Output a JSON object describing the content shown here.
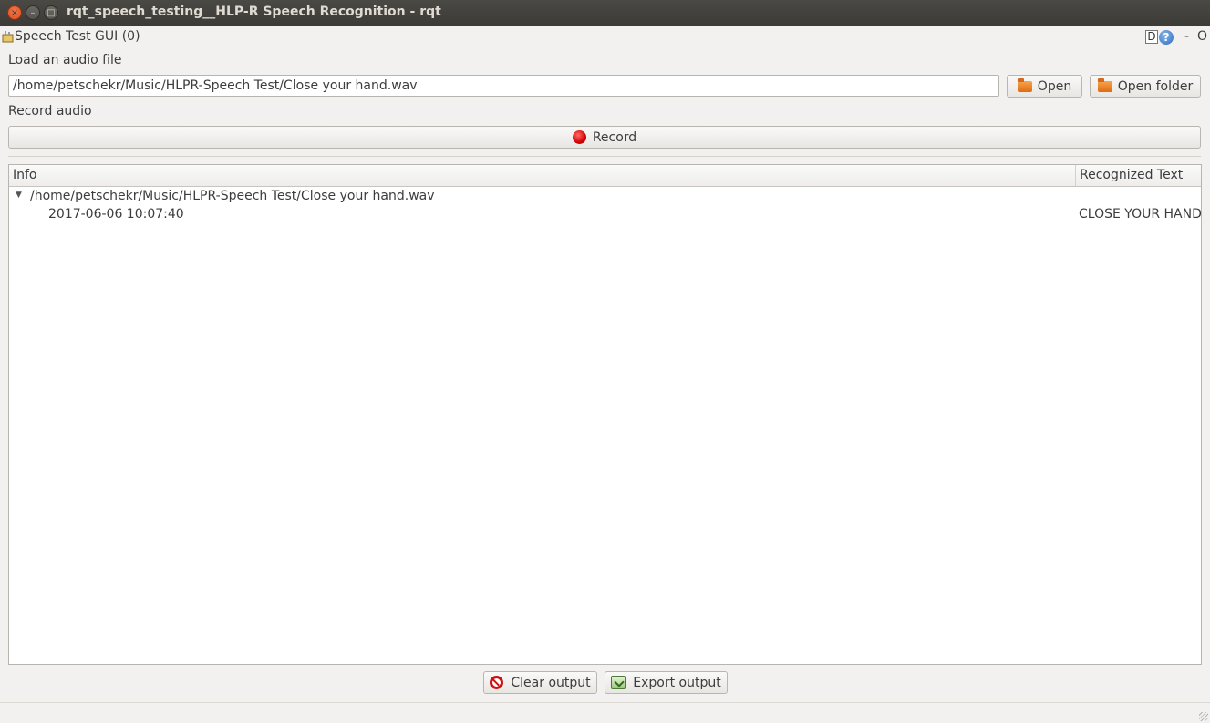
{
  "window": {
    "title": "rqt_speech_testing__HLP-R Speech Recognition - rqt",
    "close_glyph": "×",
    "min_glyph": "–",
    "max_glyph": "□"
  },
  "dock": {
    "plugin_title": "Speech Test GUI (0)",
    "d_label": "D",
    "help_label": "?",
    "min_label": "-",
    "close_label": "O"
  },
  "load": {
    "label": "Load an audio file",
    "path_value": "/home/petschekr/Music/HLPR-Speech Test/Close your hand.wav",
    "open_label": "Open",
    "open_folder_label": "Open folder"
  },
  "record": {
    "label": "Record audio",
    "button_label": "Record"
  },
  "tree": {
    "columns": [
      "Info",
      "Recognized Text"
    ],
    "rows": [
      {
        "info": "/home/petschekr/Music/HLPR-Speech Test/Close your hand.wav",
        "text": "",
        "expanded": true
      },
      {
        "info": "2017-06-06 10:07:40",
        "text": "CLOSE YOUR HAND"
      }
    ]
  },
  "footer": {
    "clear_label": "Clear output",
    "export_label": "Export output"
  },
  "colors": {
    "titlebar": "#3c3b37",
    "window_bg": "#f2f1f0",
    "close_btn": "#df4a16",
    "record_red": "#d40000"
  }
}
